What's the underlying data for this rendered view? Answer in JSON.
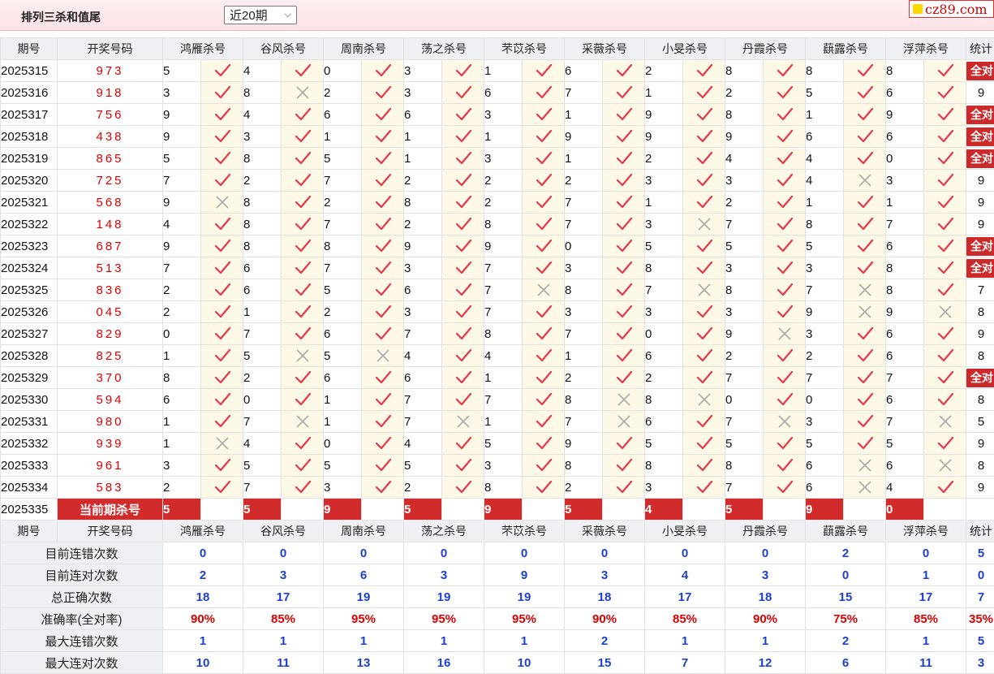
{
  "header": {
    "title": "排列三杀和值尾",
    "period_select": "近20期",
    "logo": "cz89.com"
  },
  "colors": {
    "accent_red": "#d22b2b",
    "check": "#e5384a",
    "blue": "#1b3fd0"
  },
  "columns": {
    "issue": "期号",
    "numbers": "开奖号码",
    "experts": [
      "鸿雁杀号",
      "谷风杀号",
      "周南杀号",
      "荡之杀号",
      "芣苡杀号",
      "采薇杀号",
      "小旻杀号",
      "丹霞杀号",
      "蕻露杀号",
      "浮萍杀号"
    ],
    "stat": "统计"
  },
  "rows": [
    {
      "issue": "2025315",
      "nums": "973",
      "preds": [
        [
          5,
          1
        ],
        [
          4,
          1
        ],
        [
          0,
          1
        ],
        [
          3,
          1
        ],
        [
          1,
          1
        ],
        [
          6,
          1
        ],
        [
          2,
          1
        ],
        [
          8,
          1
        ],
        [
          8,
          1
        ],
        [
          8,
          1
        ]
      ],
      "stat": "全对"
    },
    {
      "issue": "2025316",
      "nums": "918",
      "preds": [
        [
          3,
          1
        ],
        [
          8,
          0
        ],
        [
          2,
          1
        ],
        [
          3,
          1
        ],
        [
          6,
          1
        ],
        [
          7,
          1
        ],
        [
          1,
          1
        ],
        [
          2,
          1
        ],
        [
          5,
          1
        ],
        [
          6,
          1
        ]
      ],
      "stat": "9"
    },
    {
      "issue": "2025317",
      "nums": "756",
      "preds": [
        [
          9,
          1
        ],
        [
          4,
          1
        ],
        [
          6,
          1
        ],
        [
          6,
          1
        ],
        [
          3,
          1
        ],
        [
          1,
          1
        ],
        [
          9,
          1
        ],
        [
          8,
          1
        ],
        [
          1,
          1
        ],
        [
          9,
          1
        ]
      ],
      "stat": "全对"
    },
    {
      "issue": "2025318",
      "nums": "438",
      "preds": [
        [
          9,
          1
        ],
        [
          3,
          1
        ],
        [
          1,
          1
        ],
        [
          1,
          1
        ],
        [
          1,
          1
        ],
        [
          9,
          1
        ],
        [
          9,
          1
        ],
        [
          9,
          1
        ],
        [
          6,
          1
        ],
        [
          6,
          1
        ]
      ],
      "stat": "全对"
    },
    {
      "issue": "2025319",
      "nums": "865",
      "preds": [
        [
          5,
          1
        ],
        [
          8,
          1
        ],
        [
          5,
          1
        ],
        [
          1,
          1
        ],
        [
          3,
          1
        ],
        [
          1,
          1
        ],
        [
          2,
          1
        ],
        [
          4,
          1
        ],
        [
          4,
          1
        ],
        [
          0,
          1
        ]
      ],
      "stat": "全对"
    },
    {
      "issue": "2025320",
      "nums": "725",
      "preds": [
        [
          7,
          1
        ],
        [
          2,
          1
        ],
        [
          7,
          1
        ],
        [
          2,
          1
        ],
        [
          2,
          1
        ],
        [
          2,
          1
        ],
        [
          3,
          1
        ],
        [
          3,
          1
        ],
        [
          4,
          0
        ],
        [
          3,
          1
        ]
      ],
      "stat": "9"
    },
    {
      "issue": "2025321",
      "nums": "568",
      "preds": [
        [
          9,
          0
        ],
        [
          8,
          1
        ],
        [
          2,
          1
        ],
        [
          8,
          1
        ],
        [
          2,
          1
        ],
        [
          7,
          1
        ],
        [
          1,
          1
        ],
        [
          2,
          1
        ],
        [
          1,
          1
        ],
        [
          1,
          1
        ]
      ],
      "stat": "9"
    },
    {
      "issue": "2025322",
      "nums": "148",
      "preds": [
        [
          4,
          1
        ],
        [
          8,
          1
        ],
        [
          7,
          1
        ],
        [
          2,
          1
        ],
        [
          8,
          1
        ],
        [
          7,
          1
        ],
        [
          3,
          0
        ],
        [
          7,
          1
        ],
        [
          8,
          1
        ],
        [
          7,
          1
        ]
      ],
      "stat": "9"
    },
    {
      "issue": "2025323",
      "nums": "687",
      "preds": [
        [
          9,
          1
        ],
        [
          8,
          1
        ],
        [
          8,
          1
        ],
        [
          9,
          1
        ],
        [
          9,
          1
        ],
        [
          0,
          1
        ],
        [
          5,
          1
        ],
        [
          5,
          1
        ],
        [
          5,
          1
        ],
        [
          6,
          1
        ]
      ],
      "stat": "全对"
    },
    {
      "issue": "2025324",
      "nums": "513",
      "preds": [
        [
          7,
          1
        ],
        [
          6,
          1
        ],
        [
          7,
          1
        ],
        [
          3,
          1
        ],
        [
          7,
          1
        ],
        [
          3,
          1
        ],
        [
          8,
          1
        ],
        [
          3,
          1
        ],
        [
          3,
          1
        ],
        [
          8,
          1
        ]
      ],
      "stat": "全对"
    },
    {
      "issue": "2025325",
      "nums": "836",
      "preds": [
        [
          2,
          1
        ],
        [
          6,
          1
        ],
        [
          5,
          1
        ],
        [
          6,
          1
        ],
        [
          7,
          0
        ],
        [
          8,
          1
        ],
        [
          7,
          0
        ],
        [
          8,
          1
        ],
        [
          7,
          0
        ],
        [
          8,
          1
        ]
      ],
      "stat": "7"
    },
    {
      "issue": "2025326",
      "nums": "045",
      "preds": [
        [
          2,
          1
        ],
        [
          1,
          1
        ],
        [
          2,
          1
        ],
        [
          3,
          1
        ],
        [
          7,
          1
        ],
        [
          3,
          1
        ],
        [
          3,
          1
        ],
        [
          3,
          1
        ],
        [
          9,
          0
        ],
        [
          9,
          0
        ]
      ],
      "stat": "8"
    },
    {
      "issue": "2025327",
      "nums": "829",
      "preds": [
        [
          0,
          1
        ],
        [
          7,
          1
        ],
        [
          6,
          1
        ],
        [
          7,
          1
        ],
        [
          8,
          1
        ],
        [
          7,
          1
        ],
        [
          0,
          1
        ],
        [
          9,
          0
        ],
        [
          3,
          1
        ],
        [
          6,
          1
        ]
      ],
      "stat": "9"
    },
    {
      "issue": "2025328",
      "nums": "825",
      "preds": [
        [
          1,
          1
        ],
        [
          5,
          0
        ],
        [
          5,
          0
        ],
        [
          4,
          1
        ],
        [
          4,
          1
        ],
        [
          1,
          1
        ],
        [
          6,
          1
        ],
        [
          2,
          1
        ],
        [
          2,
          1
        ],
        [
          6,
          1
        ]
      ],
      "stat": "8"
    },
    {
      "issue": "2025329",
      "nums": "370",
      "preds": [
        [
          8,
          1
        ],
        [
          2,
          1
        ],
        [
          6,
          1
        ],
        [
          6,
          1
        ],
        [
          1,
          1
        ],
        [
          2,
          1
        ],
        [
          2,
          1
        ],
        [
          7,
          1
        ],
        [
          7,
          1
        ],
        [
          7,
          1
        ]
      ],
      "stat": "全对"
    },
    {
      "issue": "2025330",
      "nums": "594",
      "preds": [
        [
          6,
          1
        ],
        [
          0,
          1
        ],
        [
          1,
          1
        ],
        [
          7,
          1
        ],
        [
          7,
          1
        ],
        [
          8,
          0
        ],
        [
          8,
          0
        ],
        [
          0,
          1
        ],
        [
          0,
          1
        ],
        [
          6,
          1
        ]
      ],
      "stat": "8"
    },
    {
      "issue": "2025331",
      "nums": "980",
      "preds": [
        [
          1,
          1
        ],
        [
          7,
          0
        ],
        [
          1,
          1
        ],
        [
          7,
          0
        ],
        [
          1,
          1
        ],
        [
          7,
          0
        ],
        [
          6,
          1
        ],
        [
          7,
          0
        ],
        [
          3,
          1
        ],
        [
          7,
          0
        ]
      ],
      "stat": "5"
    },
    {
      "issue": "2025332",
      "nums": "939",
      "preds": [
        [
          1,
          0
        ],
        [
          4,
          1
        ],
        [
          0,
          1
        ],
        [
          4,
          1
        ],
        [
          5,
          1
        ],
        [
          9,
          1
        ],
        [
          5,
          1
        ],
        [
          5,
          1
        ],
        [
          5,
          1
        ],
        [
          5,
          1
        ]
      ],
      "stat": "9"
    },
    {
      "issue": "2025333",
      "nums": "961",
      "preds": [
        [
          3,
          1
        ],
        [
          5,
          1
        ],
        [
          5,
          1
        ],
        [
          5,
          1
        ],
        [
          3,
          1
        ],
        [
          8,
          1
        ],
        [
          8,
          1
        ],
        [
          8,
          1
        ],
        [
          6,
          0
        ],
        [
          6,
          0
        ]
      ],
      "stat": "8"
    },
    {
      "issue": "2025334",
      "nums": "583",
      "preds": [
        [
          2,
          1
        ],
        [
          7,
          1
        ],
        [
          3,
          1
        ],
        [
          2,
          1
        ],
        [
          8,
          1
        ],
        [
          2,
          1
        ],
        [
          3,
          1
        ],
        [
          7,
          1
        ],
        [
          6,
          0
        ],
        [
          4,
          1
        ]
      ],
      "stat": "9"
    }
  ],
  "current": {
    "issue": "2025335",
    "label": "当前期杀号",
    "kills": [
      "5",
      "5",
      "9",
      "5",
      "9",
      "5",
      "4",
      "5",
      "9",
      "0"
    ]
  },
  "summary": [
    {
      "label": "目前连错次数",
      "values": [
        "0",
        "0",
        "0",
        "0",
        "0",
        "0",
        "0",
        "0",
        "2",
        "0"
      ],
      "stat": "5",
      "style": "blue"
    },
    {
      "label": "目前连对次数",
      "values": [
        "2",
        "3",
        "6",
        "3",
        "9",
        "3",
        "4",
        "3",
        "0",
        "1"
      ],
      "stat": "0",
      "style": "blue"
    },
    {
      "label": "总正确次数",
      "values": [
        "18",
        "17",
        "19",
        "19",
        "19",
        "18",
        "17",
        "18",
        "15",
        "17"
      ],
      "stat": "7",
      "style": "blue"
    },
    {
      "label": "准确率(全对率)",
      "values": [
        "90%",
        "85%",
        "95%",
        "95%",
        "95%",
        "90%",
        "85%",
        "90%",
        "75%",
        "85%"
      ],
      "stat": "35%",
      "style": "red"
    },
    {
      "label": "最大连错次数",
      "values": [
        "1",
        "1",
        "1",
        "1",
        "1",
        "2",
        "1",
        "1",
        "2",
        "1"
      ],
      "stat": "5",
      "style": "blue"
    },
    {
      "label": "最大连对次数",
      "values": [
        "10",
        "11",
        "13",
        "16",
        "10",
        "15",
        "7",
        "12",
        "6",
        "11"
      ],
      "stat": "3",
      "style": "blue"
    }
  ]
}
